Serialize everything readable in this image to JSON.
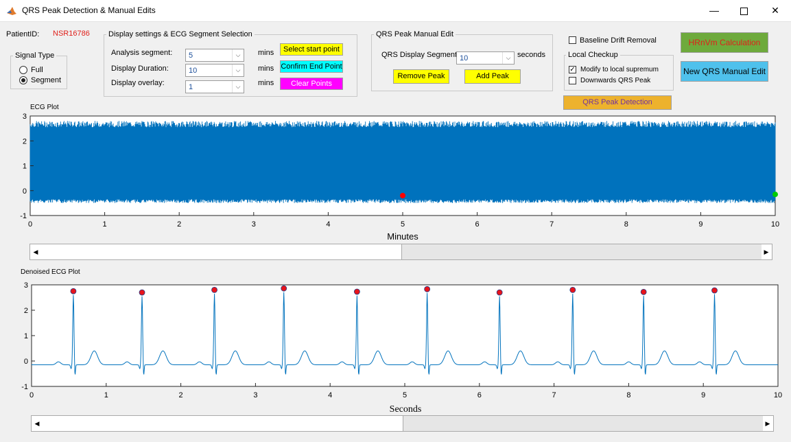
{
  "window": {
    "title": "QRS Peak Detection & Manual Edits",
    "controls": [
      "—",
      "☐",
      "✕"
    ]
  },
  "patient": {
    "label": "PatientID:",
    "id": "NSR16786",
    "id_color": "#e0201b"
  },
  "signal_type": {
    "title": "Signal Type",
    "options": [
      {
        "label": "Full",
        "selected": false
      },
      {
        "label": "Segment",
        "selected": true
      }
    ]
  },
  "display_settings": {
    "title": "Display settings & ECG Segment Selection",
    "rows": [
      {
        "label": "Analysis segment:",
        "value": "5",
        "unit": "mins"
      },
      {
        "label": "Display Duration:",
        "value": "10",
        "unit": "mins"
      },
      {
        "label": "Display overlay:",
        "value": "1",
        "unit": "mins"
      }
    ],
    "buttons": [
      {
        "label": "Select start point",
        "color": "#ffff00"
      },
      {
        "label": "Confirm End Point",
        "color": "#00ffff"
      },
      {
        "label": "Clear Points",
        "color": "#ff00ff",
        "text_color": "#ffffff"
      }
    ]
  },
  "qrs_manual_edit": {
    "title": "QRS Peak Manual Edit",
    "segment_label": "QRS Display Segment:",
    "segment_value": "10",
    "segment_unit": "seconds",
    "remove_label": "Remove Peak",
    "add_label": "Add Peak"
  },
  "baseline": {
    "label": "Baseline Drift Removal",
    "checked": false
  },
  "local_checkup": {
    "title": "Local Checkup",
    "options": [
      {
        "label": "Modify to local supremum",
        "checked": true
      },
      {
        "label": "Downwards QRS Peak",
        "checked": false
      }
    ]
  },
  "hrnvm_button": {
    "label": "HRnVm Calculation",
    "color": "#6eaa3c",
    "text_color": "#e0201b"
  },
  "new_qrs_button": {
    "label": "New QRS Manual Edit",
    "color": "#4fc1ec"
  },
  "qrs_detect_button": {
    "label": "QRS Peak Detection",
    "color": "#edb22d",
    "text_color": "#7030a0"
  },
  "ecg_plot": {
    "title": "ECG Plot",
    "xlabel": "Minutes",
    "line_color": "#0072bd",
    "chart_data": {
      "type": "line",
      "x_ticks": [
        "0",
        "1",
        "2",
        "3",
        "4",
        "5",
        "6",
        "7",
        "8",
        "9",
        "10"
      ],
      "y_ticks": [
        "3",
        "2",
        "1",
        "0",
        "-1"
      ],
      "xlim": [
        0,
        10
      ],
      "ylim": [
        -1,
        3
      ],
      "markers": [
        {
          "x": 5.0,
          "y": -0.2,
          "color": "#ff0000"
        },
        {
          "x": 10.0,
          "y": -0.15,
          "color": "#00cc00"
        }
      ]
    }
  },
  "denoised_plot": {
    "title": "Denoised ECG Plot",
    "xlabel": "Seconds",
    "line_color": "#0072bd",
    "marker_color": "#e8141b",
    "chart_data": {
      "type": "line",
      "x_ticks": [
        "0",
        "1",
        "2",
        "3",
        "4",
        "5",
        "6",
        "7",
        "8",
        "9",
        "10"
      ],
      "y_ticks": [
        "3",
        "2",
        "1",
        "0",
        "-1"
      ],
      "xlim": [
        0,
        10
      ],
      "ylim": [
        -1,
        3
      ],
      "peaks": [
        {
          "x": 0.56,
          "y": 2.75
        },
        {
          "x": 1.48,
          "y": 2.7
        },
        {
          "x": 2.45,
          "y": 2.8
        },
        {
          "x": 3.38,
          "y": 2.86
        },
        {
          "x": 4.36,
          "y": 2.73
        },
        {
          "x": 5.3,
          "y": 2.83
        },
        {
          "x": 6.27,
          "y": 2.7
        },
        {
          "x": 7.25,
          "y": 2.8
        },
        {
          "x": 8.2,
          "y": 2.72
        },
        {
          "x": 9.15,
          "y": 2.78
        }
      ]
    }
  },
  "scrollbars": [
    {
      "position": 0.5
    },
    {
      "position": 0.5
    }
  ]
}
